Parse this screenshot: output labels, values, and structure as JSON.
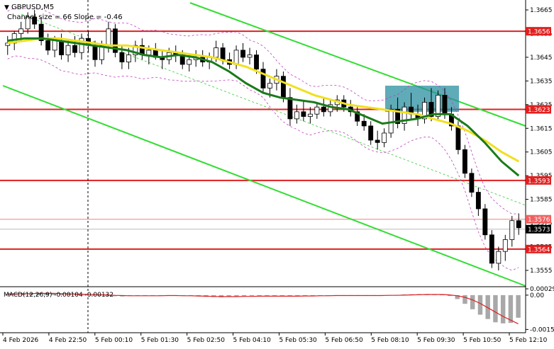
{
  "chart_data": [
    {
      "type": "candlestick",
      "symbol": "GBPUSD,M5",
      "subtitle": "Channel size = 66 Slope = -0.46",
      "x_ticks": [
        "4 Feb 2026",
        "4 Feb 22:50",
        "5 Feb 00:10",
        "5 Feb 01:30",
        "5 Feb 02:50",
        "5 Feb 04:10",
        "5 Feb 05:30",
        "5 Feb 06:50",
        "5 Feb 08:10",
        "5 Feb 09:30",
        "5 Feb 10:50",
        "5 Feb 12:10"
      ],
      "ylim": [
        1.3549,
        1.3668
      ],
      "y_ticks": [
        "1.3665",
        "1.3655",
        "1.3645",
        "1.3635",
        "1.3625",
        "1.3615",
        "1.3605",
        "1.3595",
        "1.3585",
        "1.3575",
        "1.3565",
        "1.3555"
      ],
      "levels": [
        {
          "value": 1.3656,
          "label": "1.3656",
          "color": "#e02020"
        },
        {
          "value": 1.3623,
          "label": "1.3623",
          "color": "#e02020"
        },
        {
          "value": 1.3593,
          "label": "1.3593",
          "color": "#e02020"
        },
        {
          "value": 1.3564,
          "label": "1.3564",
          "color": "#e02020"
        }
      ],
      "price_tags": [
        {
          "value": 1.3576,
          "label": "1.3576",
          "color": "#f06060"
        },
        {
          "value": 1.3573,
          "label": "1.3573",
          "color": "#000000"
        }
      ],
      "candles_ohlc": [
        [
          1.365,
          1.3654,
          1.3646,
          1.3651
        ],
        [
          1.3651,
          1.3656,
          1.3648,
          1.3655
        ],
        [
          1.3655,
          1.366,
          1.3652,
          1.3657
        ],
        [
          1.3657,
          1.3664,
          1.3655,
          1.3662
        ],
        [
          1.3662,
          1.3665,
          1.3657,
          1.3659
        ],
        [
          1.3659,
          1.3662,
          1.365,
          1.3652
        ],
        [
          1.3652,
          1.3655,
          1.3646,
          1.3648
        ],
        [
          1.3648,
          1.3654,
          1.3645,
          1.3652
        ],
        [
          1.3652,
          1.3655,
          1.3644,
          1.3646
        ],
        [
          1.3646,
          1.3652,
          1.3643,
          1.365
        ],
        [
          1.365,
          1.3654,
          1.3645,
          1.3647
        ],
        [
          1.3647,
          1.3655,
          1.3644,
          1.3653
        ],
        [
          1.3653,
          1.3656,
          1.3647,
          1.365
        ],
        [
          1.365,
          1.3652,
          1.3641,
          1.3644
        ],
        [
          1.3644,
          1.3652,
          1.3642,
          1.365
        ],
        [
          1.365,
          1.366,
          1.3647,
          1.3657
        ],
        [
          1.3657,
          1.3659,
          1.3645,
          1.3647
        ],
        [
          1.3647,
          1.365,
          1.364,
          1.3643
        ],
        [
          1.3643,
          1.3649,
          1.364,
          1.3646
        ],
        [
          1.3646,
          1.3652,
          1.3643,
          1.365
        ],
        [
          1.365,
          1.3653,
          1.3644,
          1.3646
        ],
        [
          1.3646,
          1.365,
          1.3642,
          1.3648
        ],
        [
          1.3648,
          1.3651,
          1.3644,
          1.3645
        ],
        [
          1.3645,
          1.3648,
          1.364,
          1.3644
        ],
        [
          1.3644,
          1.3649,
          1.3642,
          1.3647
        ],
        [
          1.3647,
          1.365,
          1.3643,
          1.3646
        ],
        [
          1.3646,
          1.3648,
          1.364,
          1.3642
        ],
        [
          1.3642,
          1.3646,
          1.3639,
          1.3644
        ],
        [
          1.3644,
          1.3648,
          1.3641,
          1.3645
        ],
        [
          1.3645,
          1.3648,
          1.3641,
          1.3643
        ],
        [
          1.3643,
          1.3647,
          1.364,
          1.3645
        ],
        [
          1.3645,
          1.3652,
          1.3643,
          1.3649
        ],
        [
          1.3649,
          1.3651,
          1.3642,
          1.3644
        ],
        [
          1.3644,
          1.3647,
          1.364,
          1.3642
        ],
        [
          1.3642,
          1.365,
          1.364,
          1.3648
        ],
        [
          1.3648,
          1.3651,
          1.3643,
          1.3645
        ],
        [
          1.3645,
          1.3649,
          1.3642,
          1.3646
        ],
        [
          1.3646,
          1.3648,
          1.3638,
          1.364
        ],
        [
          1.364,
          1.3643,
          1.363,
          1.3632
        ],
        [
          1.3632,
          1.3636,
          1.3628,
          1.3634
        ],
        [
          1.3634,
          1.364,
          1.3631,
          1.3637
        ],
        [
          1.3637,
          1.3639,
          1.3626,
          1.3628
        ],
        [
          1.3628,
          1.3632,
          1.3616,
          1.3619
        ],
        [
          1.3619,
          1.3625,
          1.3617,
          1.3622
        ],
        [
          1.3622,
          1.3627,
          1.3618,
          1.362
        ],
        [
          1.362,
          1.3624,
          1.3617,
          1.3621
        ],
        [
          1.3621,
          1.3626,
          1.3619,
          1.3624
        ],
        [
          1.3624,
          1.3628,
          1.362,
          1.3622
        ],
        [
          1.3622,
          1.3627,
          1.362,
          1.3625
        ],
        [
          1.3625,
          1.3629,
          1.3622,
          1.3627
        ],
        [
          1.3627,
          1.3629,
          1.3622,
          1.3624
        ],
        [
          1.3624,
          1.3627,
          1.362,
          1.3622
        ],
        [
          1.3622,
          1.3624,
          1.3616,
          1.3618
        ],
        [
          1.3618,
          1.3621,
          1.3614,
          1.3616
        ],
        [
          1.3616,
          1.3618,
          1.3608,
          1.361
        ],
        [
          1.361,
          1.3614,
          1.3606,
          1.3609
        ],
        [
          1.3609,
          1.3615,
          1.3607,
          1.3613
        ],
        [
          1.3613,
          1.3625,
          1.3611,
          1.3623
        ],
        [
          1.3623,
          1.3628,
          1.3615,
          1.3617
        ],
        [
          1.3617,
          1.3626,
          1.3614,
          1.3624
        ],
        [
          1.3624,
          1.363,
          1.3619,
          1.3621
        ],
        [
          1.3621,
          1.3625,
          1.3616,
          1.3619
        ],
        [
          1.3619,
          1.3628,
          1.3617,
          1.3626
        ],
        [
          1.3626,
          1.3632,
          1.3618,
          1.362
        ],
        [
          1.362,
          1.3631,
          1.3618,
          1.3629
        ],
        [
          1.3629,
          1.3632,
          1.3619,
          1.3621
        ],
        [
          1.3621,
          1.3624,
          1.3614,
          1.3616
        ],
        [
          1.3616,
          1.3618,
          1.3604,
          1.3606
        ],
        [
          1.3606,
          1.3608,
          1.3594,
          1.3596
        ],
        [
          1.3596,
          1.3598,
          1.3586,
          1.3588
        ],
        [
          1.3588,
          1.359,
          1.3578,
          1.3581
        ],
        [
          1.3581,
          1.3583,
          1.3568,
          1.357
        ],
        [
          1.357,
          1.3572,
          1.3556,
          1.3558
        ],
        [
          1.3558,
          1.3565,
          1.3555,
          1.3563
        ],
        [
          1.3563,
          1.357,
          1.3559,
          1.3568
        ],
        [
          1.3568,
          1.3578,
          1.3565,
          1.3576
        ],
        [
          1.3576,
          1.3579,
          1.357,
          1.3573
        ]
      ],
      "ma_yellow": [
        1.3651,
        1.3652,
        1.3653,
        1.3653,
        1.3652,
        1.3651,
        1.365,
        1.365,
        1.3649,
        1.3648,
        1.3647,
        1.3646,
        1.3645,
        1.3643,
        1.3641,
        1.3638,
        1.3635,
        1.3632,
        1.3629,
        1.3627,
        1.3625,
        1.3624,
        1.3623,
        1.3622,
        1.3621,
        1.3619,
        1.3617,
        1.3614,
        1.361,
        1.3605,
        1.3601
      ],
      "ma_green": [
        1.3652,
        1.3653,
        1.3653,
        1.3652,
        1.3651,
        1.365,
        1.3649,
        1.3648,
        1.3646,
        1.3645,
        1.3646,
        1.3645,
        1.3643,
        1.3639,
        1.3634,
        1.363,
        1.3628,
        1.3627,
        1.3626,
        1.3624,
        1.3623,
        1.362,
        1.3617,
        1.3618,
        1.3619,
        1.3621,
        1.3621,
        1.3616,
        1.3609,
        1.3601,
        1.3595
      ],
      "macd": {
        "label": "MACD(12,26,9) -0.00104 -0.00132",
        "ylim": [
          -0.0016,
          0.00029
        ],
        "y_ticks": [
          "0.00029",
          "0.00",
          "-0.00158"
        ],
        "histogram": [
          5e-05,
          6e-05,
          8e-05,
          0.0001,
          9e-05,
          8e-05,
          7e-05,
          6e-05,
          4e-05,
          2e-05,
          1e-05,
          0.0,
          -1e-05,
          -3e-05,
          -5e-05,
          -6e-05,
          -4e-05,
          -3e-05,
          -2e-05,
          -2e-05,
          -1e-05,
          -1e-05,
          -2e-05,
          -3e-05,
          -4e-05,
          -6e-05,
          -8e-05,
          -9e-05,
          -0.0001,
          -8e-05,
          -6e-05,
          -5e-05,
          -4e-05,
          -4e-05,
          -5e-05,
          -6e-05,
          -6e-05,
          -5e-05,
          -4e-05,
          -3e-05,
          -3e-05,
          -2e-05,
          -1e-05,
          -1e-05,
          -2e-05,
          -2e-05,
          -3e-05,
          -3e-05,
          -2e-05,
          -1e-05,
          0.0,
          1e-05,
          3e-05,
          4e-05,
          5e-05,
          5e-05,
          4e-05,
          2e-05,
          -4e-05,
          -0.00018,
          -0.0004,
          -0.00065,
          -0.0009,
          -0.0011,
          -0.00125,
          -0.0013,
          -0.00128,
          -0.00104
        ],
        "signal": [
          6e-05,
          6e-05,
          7e-05,
          7e-05,
          8e-05,
          8e-05,
          8e-05,
          7e-05,
          6e-05,
          5e-05,
          4e-05,
          3e-05,
          2e-05,
          1e-05,
          -1e-05,
          -2e-05,
          -3e-05,
          -3e-05,
          -3e-05,
          -3e-05,
          -3e-05,
          -2e-05,
          -2e-05,
          -3e-05,
          -3e-05,
          -4e-05,
          -5e-05,
          -6e-05,
          -7e-05,
          -7e-05,
          -7e-05,
          -6e-05,
          -6e-05,
          -5e-05,
          -5e-05,
          -5e-05,
          -5e-05,
          -5e-05,
          -5e-05,
          -4e-05,
          -4e-05,
          -3e-05,
          -3e-05,
          -2e-05,
          -2e-05,
          -2e-05,
          -2e-05,
          -2e-05,
          -2e-05,
          -2e-05,
          -1e-05,
          -1e-05,
          0.0,
          1e-05,
          2e-05,
          3e-05,
          3e-05,
          3e-05,
          1e-05,
          -3e-05,
          -0.0001,
          -0.00022,
          -0.00038,
          -0.00058,
          -0.00078,
          -0.00098,
          -0.00115,
          -0.00132
        ]
      }
    }
  ]
}
